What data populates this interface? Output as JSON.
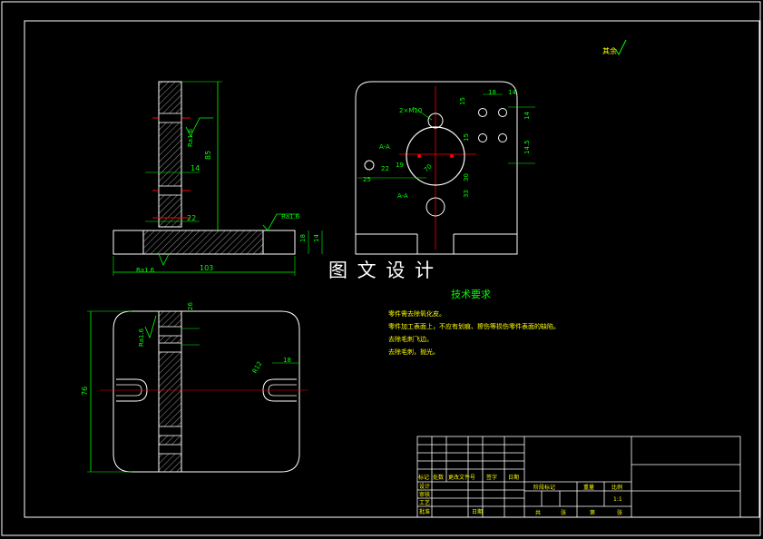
{
  "watermark": "图 文 设 计",
  "roughness_note": "其余",
  "tech_requirements": {
    "title": "技术要求",
    "items": [
      "零件需去除氧化皮。",
      "零件加工表面上，不应有划痕、擦伤等损伤零件表面的缺陷。",
      "去除毛刺飞边。",
      "去除毛刺，抛光。"
    ]
  },
  "front_view": {
    "height_dim": "85",
    "width_dim": "103",
    "thk_dim": "14",
    "base_dim": "22",
    "side_dim1": "18",
    "side_dim2": "14",
    "roughness1": "Ra1.6",
    "roughness2": "Ra1.6",
    "roughness3": "Ra1.6"
  },
  "side_view": {
    "hole_label": "2×M10",
    "dims": [
      "18",
      "14",
      "15",
      "14",
      "15",
      "14.5",
      "19",
      "30",
      "33",
      "70",
      "25",
      "22"
    ],
    "section_a": "A-A"
  },
  "top_view": {
    "height_dim": "76",
    "slot_dim": "R12",
    "slot_width": "18",
    "dim_top": "26",
    "roughness": "Ra1.6"
  },
  "title_block": {
    "col_labels": [
      "标记",
      "处数",
      "更改文件号",
      "签字",
      "日期"
    ],
    "row_labels": [
      "设计",
      "审核",
      "工艺",
      "批准"
    ],
    "mid_labels": [
      "阶段标记",
      "重量",
      "比例"
    ],
    "scale_value": "1:1",
    "bottom_labels": [
      "共",
      "张",
      "第",
      "张"
    ],
    "date_label": "日期"
  }
}
